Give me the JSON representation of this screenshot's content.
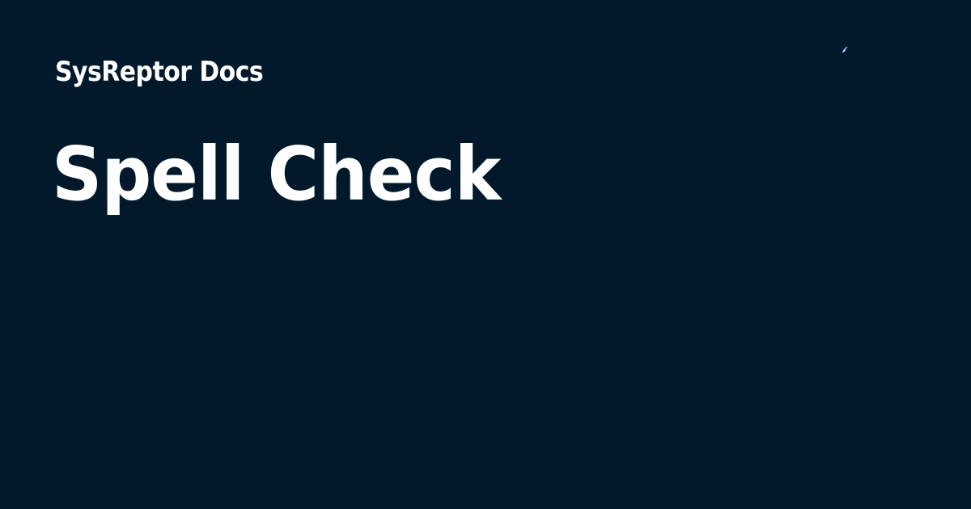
{
  "header": {
    "site_name": "SysReptor Docs"
  },
  "main": {
    "title": "Spell Check"
  },
  "decorations": {
    "logo_icon": "small-rocket-icon"
  },
  "colors": {
    "background": "#01192a",
    "text": "#ffffff",
    "logo_accent": "#6fd3ff"
  }
}
